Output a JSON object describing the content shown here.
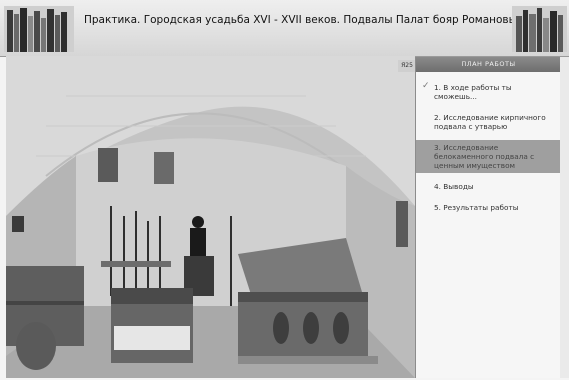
{
  "header": {
    "title": "Практика. Городская усадьба XVI - XVII веков. Подвалы Палат бояр Романовых"
  },
  "scene": {
    "corner_tab": "Я25"
  },
  "plan": {
    "heading": "ПЛАН РАБОТЫ",
    "items": [
      {
        "label": "1. В ходе работы ты сможешь...",
        "checked": true,
        "active": false
      },
      {
        "label": "2. Исследование кирпичного подвала с утварью",
        "checked": false,
        "active": false
      },
      {
        "label": "3. Исследование белокаменного подвала с ценным имуществом",
        "checked": false,
        "active": true
      },
      {
        "label": "4. Выводы",
        "checked": false,
        "active": false
      },
      {
        "label": "5. Результаты работы",
        "checked": false,
        "active": false
      }
    ],
    "check_glyph": "✓"
  }
}
